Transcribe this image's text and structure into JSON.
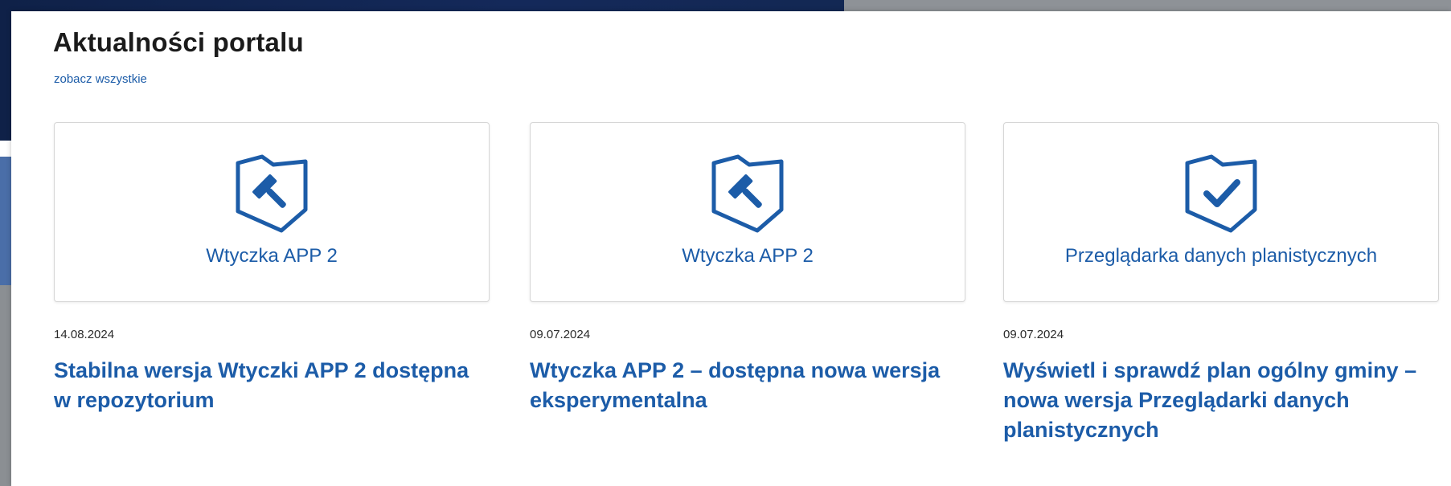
{
  "section": {
    "title": "Aktualności portalu",
    "see_all": "zobacz wszystkie"
  },
  "colors": {
    "accent": "#1c5ca8",
    "header_dark": "#14295a"
  },
  "cards": [
    {
      "icon": "shield-hammer-icon",
      "tile_label": "Wtyczka APP 2",
      "date": "14.08.2024",
      "headline": "Stabilna wersja Wtyczki APP 2 dostępna w repozytorium"
    },
    {
      "icon": "shield-hammer-icon",
      "tile_label": "Wtyczka APP 2",
      "date": "09.07.2024",
      "headline": "Wtyczka APP 2 – dostępna nowa wersja eksperymentalna"
    },
    {
      "icon": "shield-check-icon",
      "tile_label": "Przeglądarka danych planistycznych",
      "date": "09.07.2024",
      "headline": "Wyświetl i sprawdź plan ogólny gminy – nowa wersja Przeglądarki danych planistycznych"
    }
  ]
}
